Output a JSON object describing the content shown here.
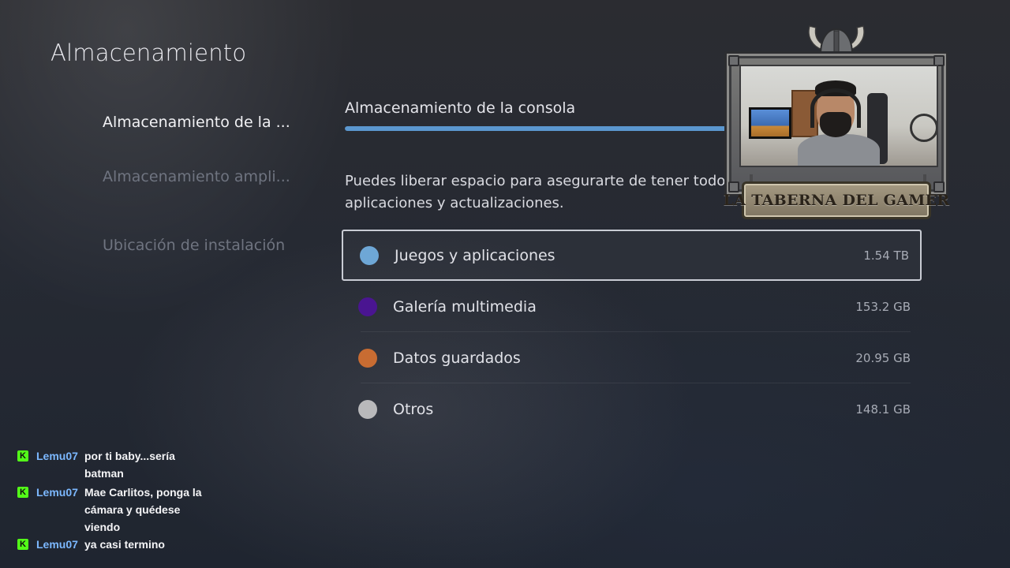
{
  "page": {
    "title": "Almacenamiento"
  },
  "sidebar": {
    "items": [
      {
        "label": "Almacenamiento de la ...",
        "state": "active"
      },
      {
        "label": "Almacenamiento ampli...",
        "state": "dim"
      },
      {
        "label": "Ubicación de instalación",
        "state": "dim"
      }
    ]
  },
  "content": {
    "section_title": "Almacenamiento de la consola",
    "usage_fraction": 0.93,
    "description": "Puedes liberar espacio para asegurarte de tener todo listo para nuevos juegos, aplicaciones y actualizaciones.",
    "categories": [
      {
        "label": "Juegos y aplicaciones",
        "size": "1.54 TB",
        "color": "#6ea7d6",
        "focused": true
      },
      {
        "label": "Galería multimedia",
        "size": "153.2 GB",
        "color": "#4a1591",
        "focused": false
      },
      {
        "label": "Datos guardados",
        "size": "20.95 GB",
        "color": "#c86c32",
        "focused": false
      },
      {
        "label": "Otros",
        "size": "148.1 GB",
        "color": "#b9b9bb",
        "focused": false
      }
    ]
  },
  "overlay": {
    "webcam_banner": "LA TABERNA DEL GAMER"
  },
  "chat": {
    "badge_letter": "K",
    "badge_color": "#53fc18",
    "messages": [
      {
        "user": "Lemu07",
        "text": "por ti baby...sería batman"
      },
      {
        "user": "Lemu07",
        "text": "Mae Carlitos, ponga la cámara y quédese viendo"
      },
      {
        "user": "Lemu07",
        "text": "ya casi termino"
      }
    ]
  }
}
